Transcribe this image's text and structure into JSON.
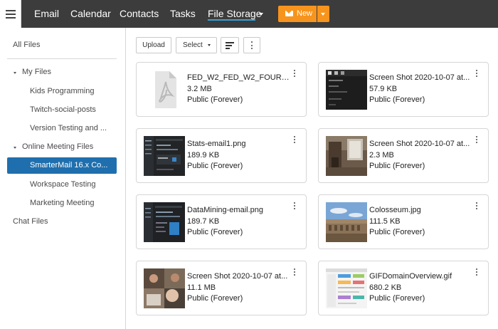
{
  "nav": {
    "items": [
      "Email",
      "Calendar",
      "Contacts",
      "Tasks",
      "File Storage"
    ],
    "new_label": "New"
  },
  "sidebar": {
    "all_files": "All Files",
    "my_files": "My Files",
    "my_files_children": [
      "Kids Programming",
      "Twitch-social-posts",
      "Version Testing and ..."
    ],
    "online_meeting_files": "Online Meeting Files",
    "online_children": [
      "SmarterMail 16.x Co...",
      "Workspace Testing",
      "Marketing Meeting"
    ],
    "chat_files": "Chat Files"
  },
  "toolbar": {
    "upload_label": "Upload",
    "select_label": "Select"
  },
  "files": [
    {
      "name": "FED_W2_FED_W2_FOUR_U...",
      "size": "3.2 MB",
      "share": "Public (Forever)",
      "thumb": "pdf"
    },
    {
      "name": "Screen Shot 2020-10-07 at...",
      "size": "57.9 KB",
      "share": "Public (Forever)",
      "thumb": "dark-list"
    },
    {
      "name": "Stats-email1.png",
      "size": "189.9 KB",
      "share": "Public (Forever)",
      "thumb": "dark-app"
    },
    {
      "name": "Screen Shot 2020-10-07 at...",
      "size": "2.3 MB",
      "share": "Public (Forever)",
      "thumb": "photo-room"
    },
    {
      "name": "DataMining-email.png",
      "size": "189.7 KB",
      "share": "Public (Forever)",
      "thumb": "dark-app2"
    },
    {
      "name": "Colosseum.jpg",
      "size": "111.5 KB",
      "share": "Public (Forever)",
      "thumb": "colosseum"
    },
    {
      "name": "Screen Shot 2020-10-07 at...",
      "size": "11.1 MB",
      "share": "Public (Forever)",
      "thumb": "video-call"
    },
    {
      "name": "GIFDomainOverview.gif",
      "size": "680.2 KB",
      "share": "Public (Forever)",
      "thumb": "light-app"
    }
  ],
  "colors": {
    "topbar": "#3c3c3c",
    "accent_new": "#f7941d",
    "selected": "#1f6fae",
    "nav_underline": "#3aa0d8"
  }
}
